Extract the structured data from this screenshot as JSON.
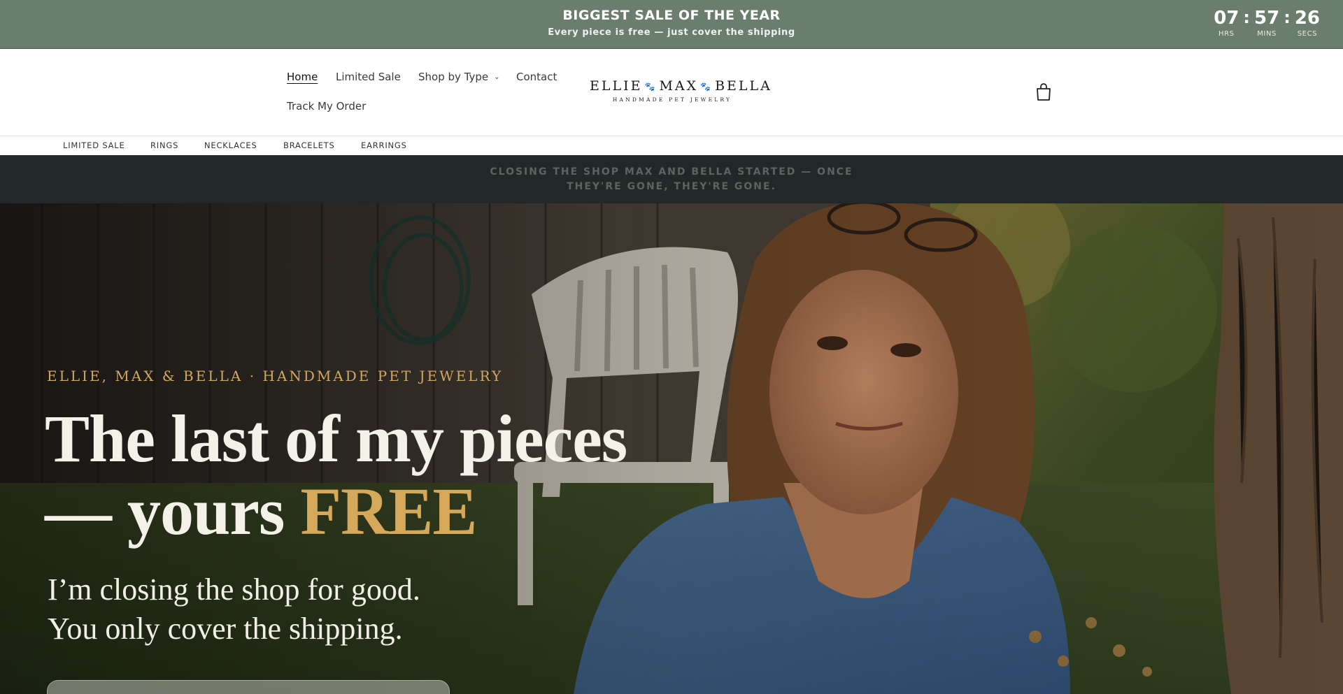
{
  "announcement": {
    "title": "BIGGEST SALE OF THE YEAR",
    "subtitle": "Every piece is free — just cover the shipping",
    "countdown": {
      "hours": "07",
      "hours_label": "HRS",
      "minutes": "57",
      "minutes_label": "MINS",
      "seconds": "26",
      "seconds_label": "SECS",
      "separator": ":"
    },
    "background_color": "#6b7d6c"
  },
  "header": {
    "nav": {
      "home": "Home",
      "limited_sale": "Limited Sale",
      "shop_by_type": "Shop by Type",
      "contact": "Contact",
      "track_order": "Track My Order"
    },
    "logo": {
      "part1": "ELLIE",
      "part2": "MAX",
      "part3": "BELLA",
      "paw": "🐾",
      "tagline": "HANDMADE PET JEWELRY"
    },
    "cart_icon": "shopping-bag-icon"
  },
  "categories": [
    "LIMITED SALE",
    "RINGS",
    "NECKLACES",
    "BRACELETS",
    "EARRINGS"
  ],
  "notice": {
    "text": "CLOSING THE SHOP MAX AND BELLA STARTED — ONCE THEY'RE GONE, THEY'RE GONE."
  },
  "hero": {
    "eyebrow": "ELLIE, MAX & BELLA · HANDMADE PET JEWELRY",
    "title_line1": "The last of my pieces",
    "title_line2_pre": "— yours ",
    "title_accent": "FREE",
    "subtitle_line1": "I’m closing the shop for good.",
    "subtitle_line2": "You only cover the shipping.",
    "accent_color": "#d6a85a"
  }
}
